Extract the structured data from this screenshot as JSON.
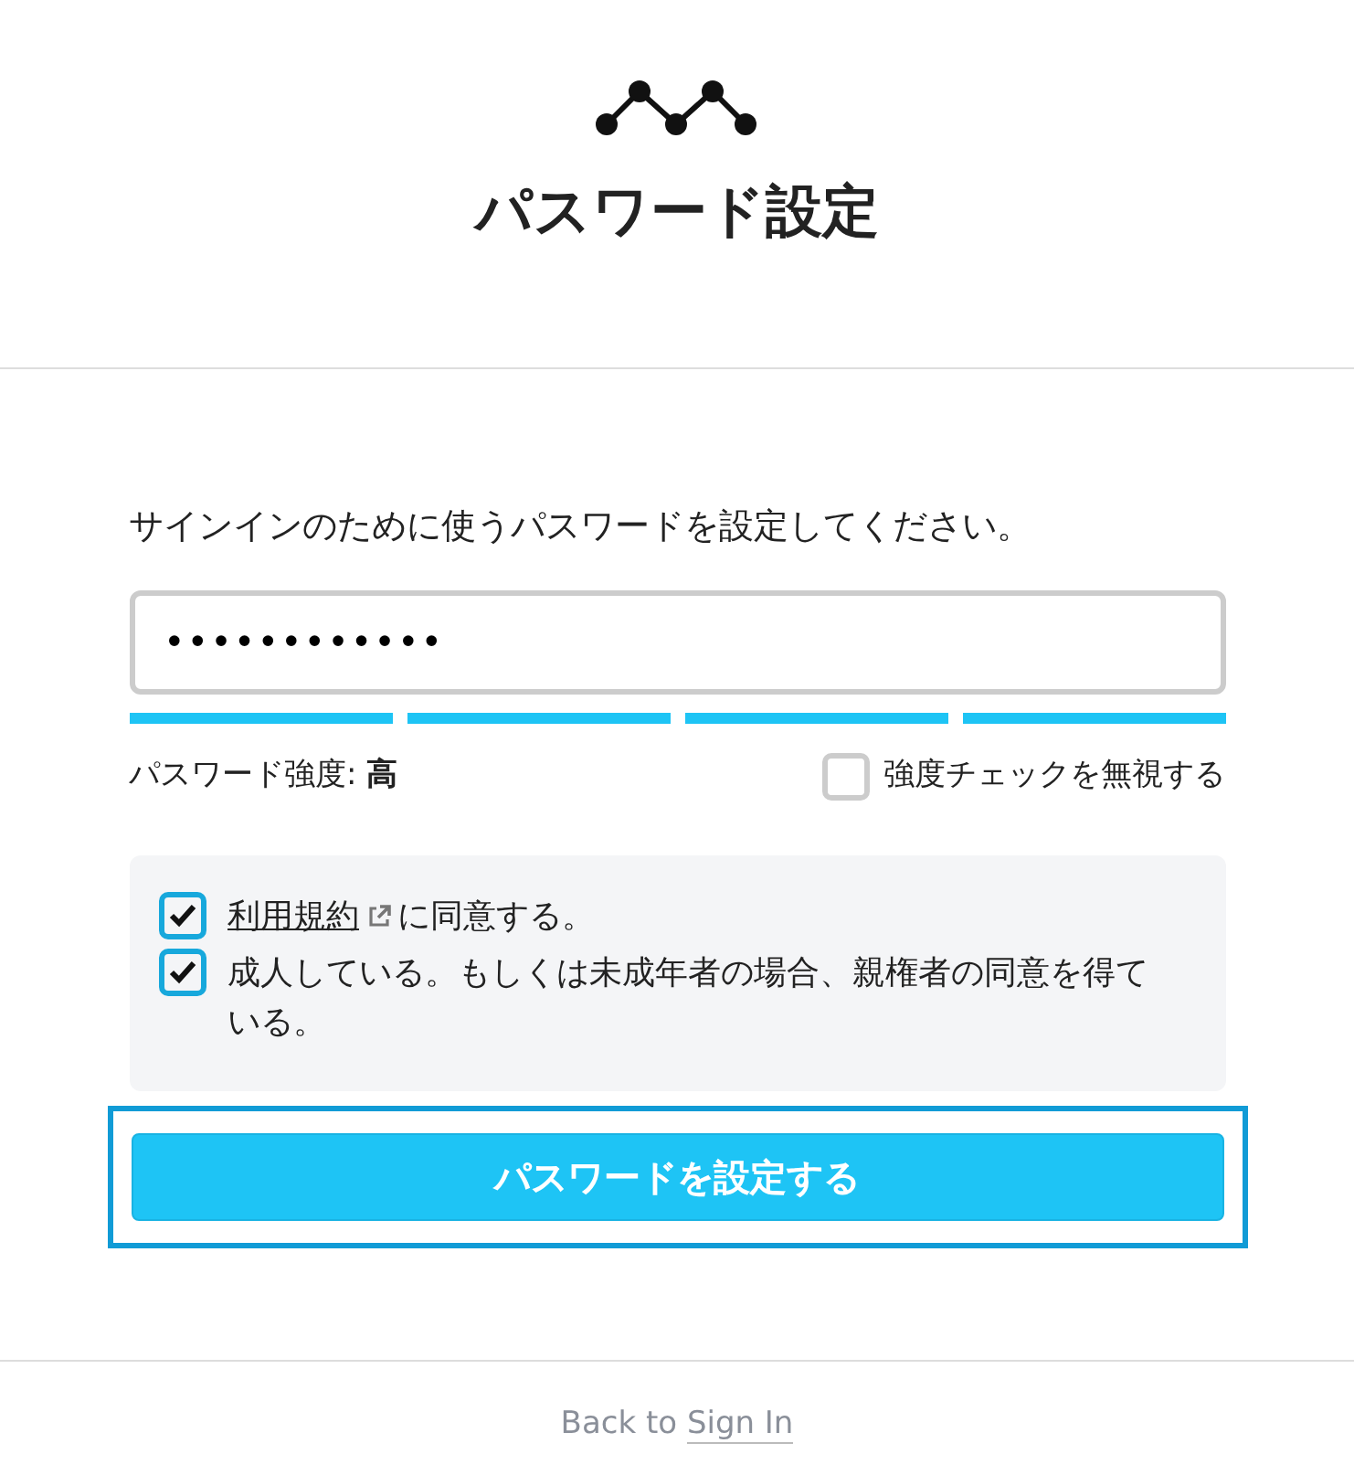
{
  "title": "パスワード設定",
  "instruction": "サインインのために使うパスワードを設定してください。",
  "password": {
    "value": "••••••••••••"
  },
  "strength_meter": {
    "segments": [
      {
        "filled": true
      },
      {
        "filled": true
      },
      {
        "filled": true
      },
      {
        "filled": true
      }
    ]
  },
  "strength_label": {
    "label": "パスワード強度:",
    "value": "高"
  },
  "ignore_check": {
    "label": "強度チェックを無視する",
    "checked": false
  },
  "agreements": [
    {
      "link": "利用規約",
      "text": "に同意する。",
      "checked": true
    },
    {
      "text": "成人している。もしくは未成年者の場合、親権者の同意を得ている。",
      "checked": true
    }
  ],
  "submit": {
    "label": "パスワードを設定する",
    "focused": true
  },
  "footer": {
    "text": "Back to",
    "link": "Sign In"
  }
}
